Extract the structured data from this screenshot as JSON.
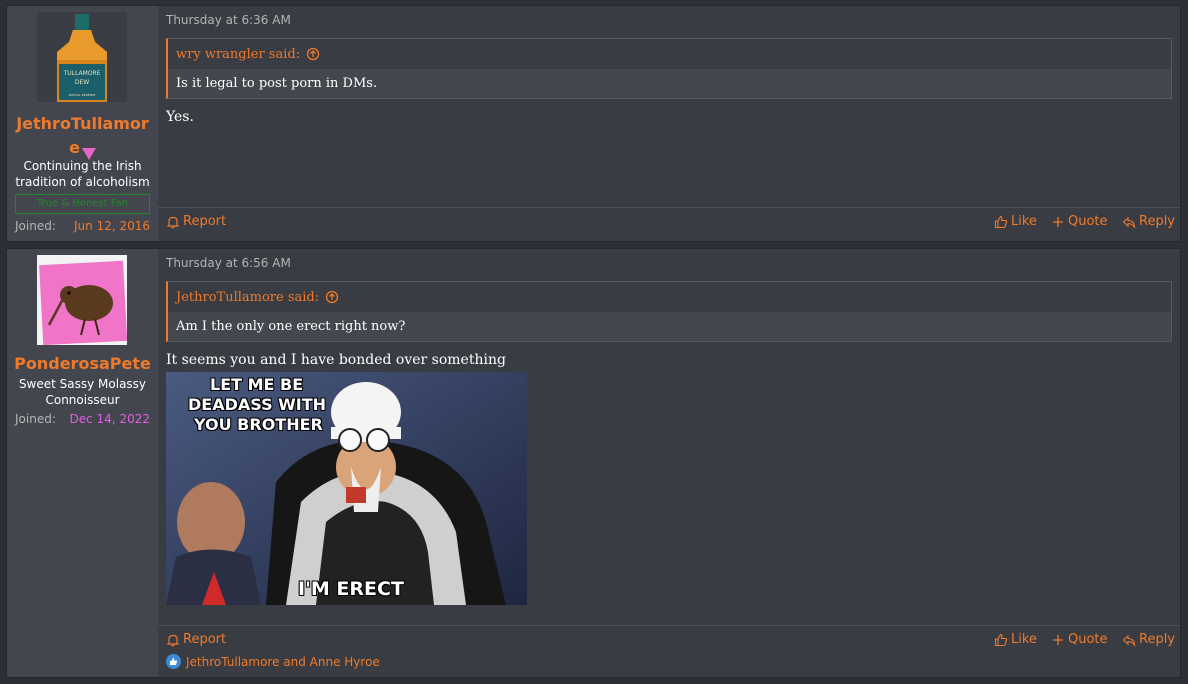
{
  "posts": [
    {
      "username": "JethroTullamore",
      "user_title": "Continuing the Irish tradition of alcoholism",
      "banner": "True & Honest Fan",
      "joined_label": "Joined:",
      "joined_date": "Jun 12, 2016",
      "date": "Thursday at 6:36 AM",
      "quote_author": "wry wrangler said:",
      "quote_text": "Is it legal to post porn in DMs.",
      "body": "Yes.",
      "avatar_text_1": "TULLAMORE",
      "avatar_text_2": "DEW",
      "avatar_text_3": "SPECIAL RESERVE"
    },
    {
      "username": "PonderosaPete",
      "user_title": "Sweet Sassy Molassy Connoisseur",
      "joined_label": "Joined:",
      "joined_date": "Dec 14, 2022",
      "date": "Thursday at 6:56 AM",
      "quote_author": "JethroTullamore said:",
      "quote_text": "Am I the only one erect right now?",
      "body": "It seems you and I have bonded over something",
      "meme_top_1": "LET ME BE",
      "meme_top_2": "DEADASS WITH",
      "meme_top_3": "YOU BROTHER",
      "meme_bottom": "I'M ERECT",
      "reactions": "JethroTullamore and Anne Hyroe"
    }
  ],
  "actions": {
    "report": "Report",
    "like": "Like",
    "quote": "Quote",
    "reply": "Reply"
  },
  "colors": {
    "accent": "#f07a2a",
    "joined_date_1": "#f07a2a",
    "joined_date_2": "#e060e0",
    "banner": "#22882b"
  }
}
